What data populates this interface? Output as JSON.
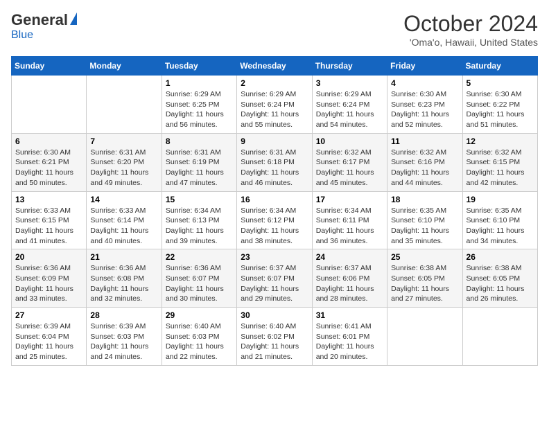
{
  "logo": {
    "general": "General",
    "blue": "Blue"
  },
  "header": {
    "month": "October 2024",
    "location": "'Oma'o, Hawaii, United States"
  },
  "days_of_week": [
    "Sunday",
    "Monday",
    "Tuesday",
    "Wednesday",
    "Thursday",
    "Friday",
    "Saturday"
  ],
  "weeks": [
    [
      {
        "day": "",
        "info": ""
      },
      {
        "day": "",
        "info": ""
      },
      {
        "day": "1",
        "info": "Sunrise: 6:29 AM\nSunset: 6:25 PM\nDaylight: 11 hours and 56 minutes."
      },
      {
        "day": "2",
        "info": "Sunrise: 6:29 AM\nSunset: 6:24 PM\nDaylight: 11 hours and 55 minutes."
      },
      {
        "day": "3",
        "info": "Sunrise: 6:29 AM\nSunset: 6:24 PM\nDaylight: 11 hours and 54 minutes."
      },
      {
        "day": "4",
        "info": "Sunrise: 6:30 AM\nSunset: 6:23 PM\nDaylight: 11 hours and 52 minutes."
      },
      {
        "day": "5",
        "info": "Sunrise: 6:30 AM\nSunset: 6:22 PM\nDaylight: 11 hours and 51 minutes."
      }
    ],
    [
      {
        "day": "6",
        "info": "Sunrise: 6:30 AM\nSunset: 6:21 PM\nDaylight: 11 hours and 50 minutes."
      },
      {
        "day": "7",
        "info": "Sunrise: 6:31 AM\nSunset: 6:20 PM\nDaylight: 11 hours and 49 minutes."
      },
      {
        "day": "8",
        "info": "Sunrise: 6:31 AM\nSunset: 6:19 PM\nDaylight: 11 hours and 47 minutes."
      },
      {
        "day": "9",
        "info": "Sunrise: 6:31 AM\nSunset: 6:18 PM\nDaylight: 11 hours and 46 minutes."
      },
      {
        "day": "10",
        "info": "Sunrise: 6:32 AM\nSunset: 6:17 PM\nDaylight: 11 hours and 45 minutes."
      },
      {
        "day": "11",
        "info": "Sunrise: 6:32 AM\nSunset: 6:16 PM\nDaylight: 11 hours and 44 minutes."
      },
      {
        "day": "12",
        "info": "Sunrise: 6:32 AM\nSunset: 6:15 PM\nDaylight: 11 hours and 42 minutes."
      }
    ],
    [
      {
        "day": "13",
        "info": "Sunrise: 6:33 AM\nSunset: 6:15 PM\nDaylight: 11 hours and 41 minutes."
      },
      {
        "day": "14",
        "info": "Sunrise: 6:33 AM\nSunset: 6:14 PM\nDaylight: 11 hours and 40 minutes."
      },
      {
        "day": "15",
        "info": "Sunrise: 6:34 AM\nSunset: 6:13 PM\nDaylight: 11 hours and 39 minutes."
      },
      {
        "day": "16",
        "info": "Sunrise: 6:34 AM\nSunset: 6:12 PM\nDaylight: 11 hours and 38 minutes."
      },
      {
        "day": "17",
        "info": "Sunrise: 6:34 AM\nSunset: 6:11 PM\nDaylight: 11 hours and 36 minutes."
      },
      {
        "day": "18",
        "info": "Sunrise: 6:35 AM\nSunset: 6:10 PM\nDaylight: 11 hours and 35 minutes."
      },
      {
        "day": "19",
        "info": "Sunrise: 6:35 AM\nSunset: 6:10 PM\nDaylight: 11 hours and 34 minutes."
      }
    ],
    [
      {
        "day": "20",
        "info": "Sunrise: 6:36 AM\nSunset: 6:09 PM\nDaylight: 11 hours and 33 minutes."
      },
      {
        "day": "21",
        "info": "Sunrise: 6:36 AM\nSunset: 6:08 PM\nDaylight: 11 hours and 32 minutes."
      },
      {
        "day": "22",
        "info": "Sunrise: 6:36 AM\nSunset: 6:07 PM\nDaylight: 11 hours and 30 minutes."
      },
      {
        "day": "23",
        "info": "Sunrise: 6:37 AM\nSunset: 6:07 PM\nDaylight: 11 hours and 29 minutes."
      },
      {
        "day": "24",
        "info": "Sunrise: 6:37 AM\nSunset: 6:06 PM\nDaylight: 11 hours and 28 minutes."
      },
      {
        "day": "25",
        "info": "Sunrise: 6:38 AM\nSunset: 6:05 PM\nDaylight: 11 hours and 27 minutes."
      },
      {
        "day": "26",
        "info": "Sunrise: 6:38 AM\nSunset: 6:05 PM\nDaylight: 11 hours and 26 minutes."
      }
    ],
    [
      {
        "day": "27",
        "info": "Sunrise: 6:39 AM\nSunset: 6:04 PM\nDaylight: 11 hours and 25 minutes."
      },
      {
        "day": "28",
        "info": "Sunrise: 6:39 AM\nSunset: 6:03 PM\nDaylight: 11 hours and 24 minutes."
      },
      {
        "day": "29",
        "info": "Sunrise: 6:40 AM\nSunset: 6:03 PM\nDaylight: 11 hours and 22 minutes."
      },
      {
        "day": "30",
        "info": "Sunrise: 6:40 AM\nSunset: 6:02 PM\nDaylight: 11 hours and 21 minutes."
      },
      {
        "day": "31",
        "info": "Sunrise: 6:41 AM\nSunset: 6:01 PM\nDaylight: 11 hours and 20 minutes."
      },
      {
        "day": "",
        "info": ""
      },
      {
        "day": "",
        "info": ""
      }
    ]
  ]
}
